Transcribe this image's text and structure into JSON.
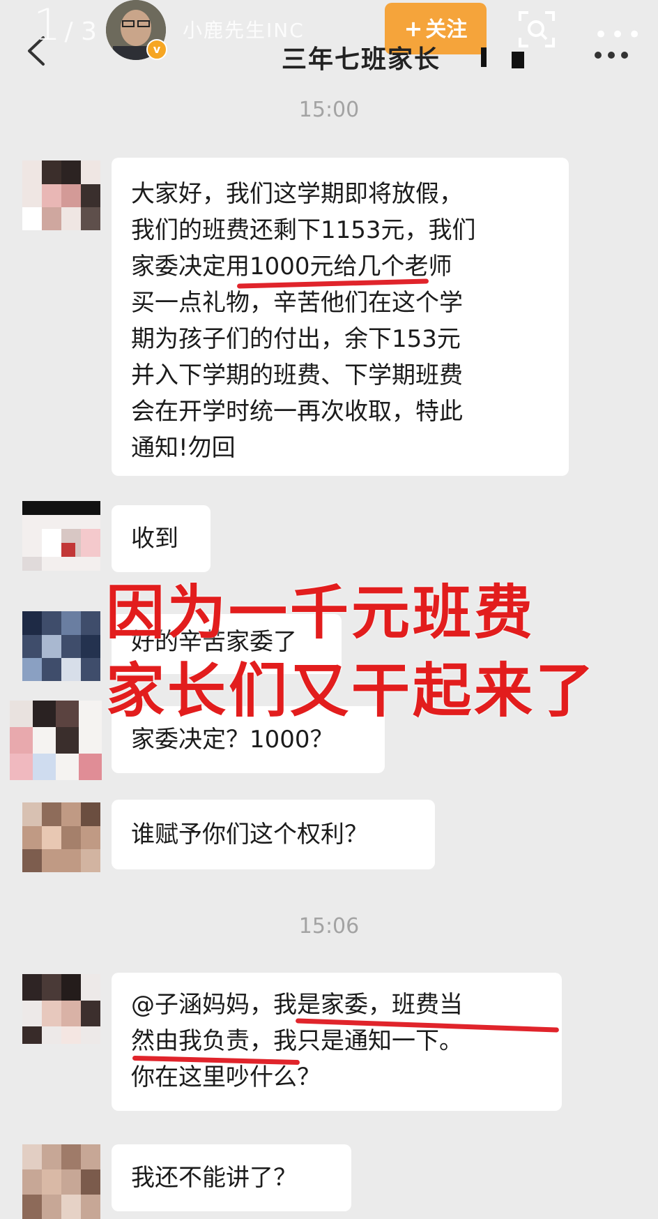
{
  "topbar": {
    "page_current": "1",
    "page_total": "/ 3",
    "username": "小鹿先生INC",
    "follow_plus": "+",
    "follow_label": "关注",
    "chat_title": "三年七班家长",
    "more_dots": "•••"
  },
  "timestamps": [
    "15:00",
    "15:06"
  ],
  "messages": [
    {
      "lines": [
        "大家好，我们这学期即将放假，",
        "我们的班费还剩下1153元，我们",
        "家委决定用1000元给几个老师",
        "买一点礼物，辛苦他们在这个学",
        "期为孩子们的付出，余下153元",
        "并入下学期的班费、下学期班费",
        "会在开学时统一再次收取，特此",
        "通知!勿回"
      ]
    },
    {
      "lines": [
        "收到"
      ]
    },
    {
      "lines": [
        "好的辛苦家委了"
      ]
    },
    {
      "lines": [
        "家委决定？1000？"
      ]
    },
    {
      "lines": [
        "谁赋予你们这个权利？"
      ]
    },
    {
      "lines": [
        "@子涵妈妈，我是家委，班费当",
        "然由我负责，我只是通知一下。",
        "你在这里吵什么？"
      ]
    },
    {
      "lines": [
        "我还不能讲了？"
      ]
    }
  ],
  "overlay": {
    "line1": "因为一千元班费",
    "line2": "家长们又干起来了"
  },
  "colors": {
    "background": "#ebebeb",
    "bubble": "#ffffff",
    "follow_button": "#f5a43b",
    "overlay_text": "#e21d1d",
    "underline": "#e0242b"
  }
}
